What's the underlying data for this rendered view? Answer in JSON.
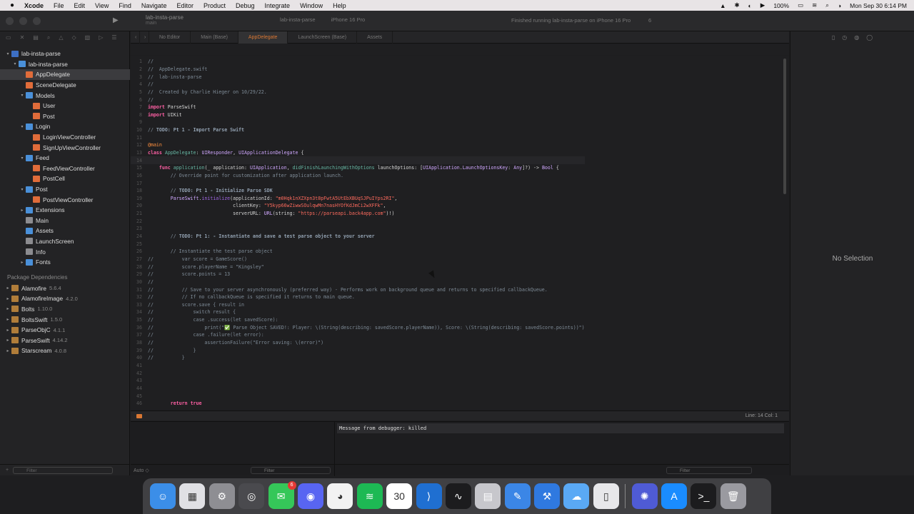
{
  "menubar": {
    "app": "Xcode",
    "items": [
      "File",
      "Edit",
      "View",
      "Find",
      "Navigate",
      "Editor",
      "Product",
      "Debug",
      "Integrate",
      "Window",
      "Help"
    ],
    "battery": "100%",
    "clock": "Mon Sep 30  6:14 PM"
  },
  "toolbar": {
    "project": "lab-insta-parse",
    "branch": "main",
    "scheme": "lab-insta-parse",
    "device": "iPhone 16 Pro",
    "status": "Finished running lab-insta-parse on iPhone 16 Pro",
    "warnings": "6"
  },
  "tabs": [
    {
      "label": "No Editor",
      "active": false
    },
    {
      "label": "Main (Base)",
      "active": false
    },
    {
      "label": "AppDelegate",
      "active": true
    },
    {
      "label": "LaunchScreen (Base)",
      "active": false
    },
    {
      "label": "Assets",
      "active": false
    }
  ],
  "navigator": {
    "tree": [
      {
        "label": "lab-insta-parse",
        "depth": 0,
        "kind": "proj",
        "chevron": "▾"
      },
      {
        "label": "lab-insta-parse",
        "depth": 1,
        "kind": "folder",
        "chevron": "▾"
      },
      {
        "label": "AppDelegate",
        "depth": 2,
        "kind": "swift",
        "chevron": "",
        "selected": true
      },
      {
        "label": "SceneDelegate",
        "depth": 2,
        "kind": "swift",
        "chevron": ""
      },
      {
        "label": "Models",
        "depth": 2,
        "kind": "folder",
        "chevron": "▾"
      },
      {
        "label": "User",
        "depth": 3,
        "kind": "swift",
        "chevron": ""
      },
      {
        "label": "Post",
        "depth": 3,
        "kind": "swift",
        "chevron": ""
      },
      {
        "label": "Login",
        "depth": 2,
        "kind": "folder",
        "chevron": "▾"
      },
      {
        "label": "LoginViewController",
        "depth": 3,
        "kind": "swift",
        "chevron": ""
      },
      {
        "label": "SignUpViewController",
        "depth": 3,
        "kind": "swift",
        "chevron": ""
      },
      {
        "label": "Feed",
        "depth": 2,
        "kind": "folder",
        "chevron": "▾"
      },
      {
        "label": "FeedViewController",
        "depth": 3,
        "kind": "swift",
        "chevron": ""
      },
      {
        "label": "PostCell",
        "depth": 3,
        "kind": "swift",
        "chevron": ""
      },
      {
        "label": "Post",
        "depth": 2,
        "kind": "folder",
        "chevron": "▾"
      },
      {
        "label": "PostViewController",
        "depth": 3,
        "kind": "swift",
        "chevron": ""
      },
      {
        "label": "Extensions",
        "depth": 2,
        "kind": "folder",
        "chevron": "▸"
      },
      {
        "label": "Main",
        "depth": 2,
        "kind": "file",
        "chevron": ""
      },
      {
        "label": "Assets",
        "depth": 2,
        "kind": "folder",
        "chevron": ""
      },
      {
        "label": "LaunchScreen",
        "depth": 2,
        "kind": "file",
        "chevron": ""
      },
      {
        "label": "Info",
        "depth": 2,
        "kind": "file",
        "chevron": ""
      },
      {
        "label": "Fonts",
        "depth": 2,
        "kind": "folder",
        "chevron": "▸"
      }
    ],
    "packages_title": "Package Dependencies",
    "packages": [
      {
        "name": "Alamofire",
        "version": "5.6.4"
      },
      {
        "name": "AlamofireImage",
        "version": "4.2.0"
      },
      {
        "name": "Bolts",
        "version": "1.10.0"
      },
      {
        "name": "BoltsSwift",
        "version": "1.5.0"
      },
      {
        "name": "ParseObjC",
        "version": "4.1.1"
      },
      {
        "name": "ParseSwift",
        "version": "4.14.2"
      },
      {
        "name": "Starscream",
        "version": "4.0.8"
      }
    ],
    "filter_placeholder": "Filter"
  },
  "editor": {
    "lines": [
      {
        "n": "1",
        "html": "<span class='c-com'>//</span>"
      },
      {
        "n": "2",
        "html": "<span class='c-com'>//  AppDelegate.swift</span>"
      },
      {
        "n": "3",
        "html": "<span class='c-com'>//  lab-insta-parse</span>"
      },
      {
        "n": "4",
        "html": "<span class='c-com'>//</span>"
      },
      {
        "n": "5",
        "html": "<span class='c-com'>//  Created by Charlie Hieger on 10/29/22.</span>"
      },
      {
        "n": "6",
        "html": "<span class='c-com'>//</span>"
      },
      {
        "n": "7",
        "html": "<span class='c-kw'>import</span> ParseSwift"
      },
      {
        "n": "8",
        "html": "<span class='c-kw'>import</span> UIKit"
      },
      {
        "n": "9",
        "html": ""
      },
      {
        "n": "10",
        "html": "<span class='c-com'>// </span><span class='c-mark'>TODO: Pt 1 - Import Parse Swift</span>"
      },
      {
        "n": "11",
        "html": ""
      },
      {
        "n": "12",
        "html": "<span class='c-attr'>@main</span>"
      },
      {
        "n": "13",
        "html": "<span class='c-kw'>class</span> <span class='c-fn'>AppDelegate</span>: <span class='c-type'>UIResponder</span>, <span class='c-type'>UIApplicationDelegate</span> {"
      },
      {
        "n": "14",
        "html": "",
        "cur": true
      },
      {
        "n": "15",
        "html": "    <span class='c-kw'>func</span> <span class='c-fn'>application</span>(_ application: <span class='c-type'>UIApplication</span>, <span class='c-fn'>didFinishLaunchingWithOptions</span> launchOptions: [<span class='c-type'>UIApplication</span>.<span class='c-type'>LaunchOptionsKey</span>: <span class='c-type'>Any</span>]?) -> <span class='c-type'>Bool</span> {"
      },
      {
        "n": "16",
        "html": "        <span class='c-com'>// Override point for customization after application launch.</span>"
      },
      {
        "n": "17",
        "html": ""
      },
      {
        "n": "18",
        "html": "        <span class='c-com'>// </span><span class='c-mark'>TODO: Pt 1 - Initialize Parse SDK</span>"
      },
      {
        "n": "19",
        "html": "        <span class='c-type'>ParseSwift</span>.<span class='c-id'>initialize</span>(applicationId: <span class='c-str'>\"m0Hqk1nXZXpn3t8pFwtA5UtEbXBUqSJPuIYps2RI\"</span>,"
      },
      {
        "n": "20",
        "html": "                              clientKey: <span class='c-str'>\"Y5kyp66wZiwwSOulqwMn7nasHYOfKdJmCi2wXFFk\"</span>,"
      },
      {
        "n": "21",
        "html": "                              serverURL: <span class='c-type'>URL</span>(string: <span class='c-str'>\"https://parseapi.back4app.com\"</span>)!)"
      },
      {
        "n": "22",
        "html": ""
      },
      {
        "n": "23",
        "html": ""
      },
      {
        "n": "24",
        "html": "        <span class='c-com'>// </span><span class='c-mark'>TODO: Pt 1: - Instantiate and save a test parse object to your server</span>"
      },
      {
        "n": "25",
        "html": ""
      },
      {
        "n": "26",
        "html": "        <span class='c-com'>// Instantiate the test parse object</span>"
      },
      {
        "n": "27",
        "html": "<span class='c-com'>//          var score = GameScore()</span>"
      },
      {
        "n": "28",
        "html": "<span class='c-com'>//          score.playerName = \"Kingsley\"</span>"
      },
      {
        "n": "29",
        "html": "<span class='c-com'>//          score.points = 13</span>"
      },
      {
        "n": "30",
        "html": "<span class='c-com'>//</span>"
      },
      {
        "n": "31",
        "html": "<span class='c-com'>//          // Save to your server asynchronously (preferred way) - Performs work on background queue and returns to specified callbackQueue.</span>"
      },
      {
        "n": "32",
        "html": "<span class='c-com'>//          // If no callbackQueue is specified it returns to main queue.</span>"
      },
      {
        "n": "33",
        "html": "<span class='c-com'>//          score.save { result in</span>"
      },
      {
        "n": "34",
        "html": "<span class='c-com'>//              switch result {</span>"
      },
      {
        "n": "35",
        "html": "<span class='c-com'>//              case .success(let savedScore):</span>"
      },
      {
        "n": "36",
        "html": "<span class='c-com'>//                  print(\"✅ Parse Object SAVED!: Player: \\(String(describing: savedScore.playerName)), Score: \\(String(describing: savedScore.points))\")</span>"
      },
      {
        "n": "37",
        "html": "<span class='c-com'>//              case .failure(let error):</span>"
      },
      {
        "n": "38",
        "html": "<span class='c-com'>//                  assertionFailure(\"Error saving: \\(error)\")</span>"
      },
      {
        "n": "39",
        "html": "<span class='c-com'>//              }</span>"
      },
      {
        "n": "40",
        "html": "<span class='c-com'>//          }</span>"
      },
      {
        "n": "41",
        "html": ""
      },
      {
        "n": "42",
        "html": ""
      },
      {
        "n": "43",
        "html": ""
      },
      {
        "n": "44",
        "html": ""
      },
      {
        "n": "45",
        "html": ""
      },
      {
        "n": "46",
        "html": "        <span class='c-kw'>return</span> <span class='c-kw'>true</span>"
      }
    ],
    "cursor_position": "Line: 14  Col: 1"
  },
  "debug": {
    "message": "Message from debugger: killed",
    "auto_label": "Auto ◇",
    "filter_placeholder": "Filter"
  },
  "inspector": {
    "empty_label": "No Selection"
  },
  "dock": [
    {
      "name": "finder",
      "color": "#3b8ee8",
      "glyph": "☺"
    },
    {
      "name": "launchpad",
      "color": "#e0e0e4",
      "glyph": "▦"
    },
    {
      "name": "system-settings",
      "color": "#8e8e93",
      "glyph": "⚙"
    },
    {
      "name": "screenshot",
      "color": "#4a4a4e",
      "glyph": "◎"
    },
    {
      "name": "messages",
      "color": "#35c759",
      "glyph": "✉",
      "badge": "6"
    },
    {
      "name": "discord",
      "color": "#5865f2",
      "glyph": "◉"
    },
    {
      "name": "chrome",
      "color": "#f2f2f2",
      "glyph": "◕"
    },
    {
      "name": "spotify",
      "color": "#1db954",
      "glyph": "≋"
    },
    {
      "name": "calendar",
      "color": "#ffffff",
      "glyph": "30"
    },
    {
      "name": "vscode",
      "color": "#1f6fd1",
      "glyph": "⟩"
    },
    {
      "name": "activity-monitor",
      "color": "#1c1c1e",
      "glyph": "∿"
    },
    {
      "name": "disk-utility",
      "color": "#c7c7cc",
      "glyph": "▤"
    },
    {
      "name": "xcode-dev",
      "color": "#3b86e6",
      "glyph": "✎"
    },
    {
      "name": "xcode",
      "color": "#2f79e0",
      "glyph": "⚒"
    },
    {
      "name": "icloud",
      "color": "#5aa9f5",
      "glyph": "☁"
    },
    {
      "name": "simulator",
      "color": "#e7e7ea",
      "glyph": "▯"
    },
    {
      "name": "instruments",
      "color": "#4f5bd5",
      "glyph": "✺"
    },
    {
      "name": "app-store",
      "color": "#1a8cff",
      "glyph": "A"
    },
    {
      "name": "terminal",
      "color": "#1c1c1e",
      "glyph": ">_"
    },
    {
      "name": "trash",
      "color": "#9a9aa0",
      "glyph": "🗑"
    }
  ]
}
